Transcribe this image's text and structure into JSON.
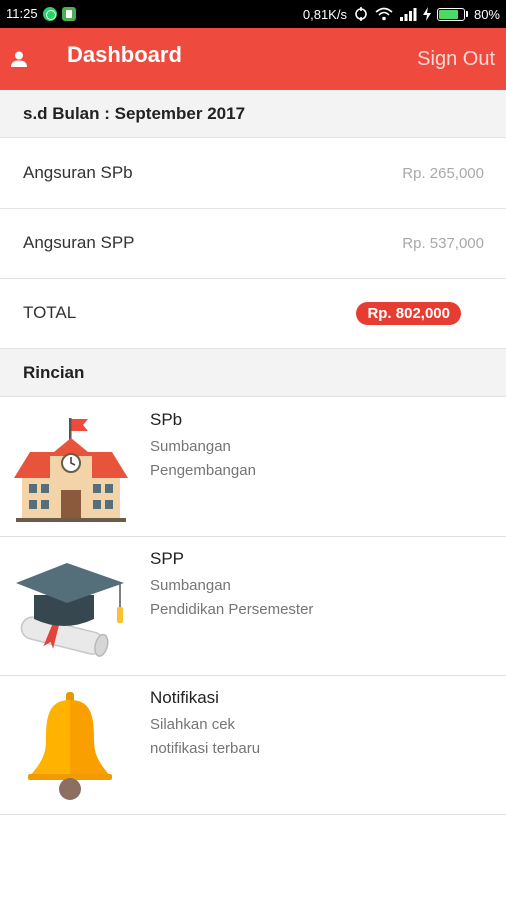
{
  "status_bar": {
    "time": "11:25",
    "network_speed": "0,81K/s",
    "battery_percent": "80%",
    "battery_level": 0.8,
    "icons": [
      "whatsapp-icon",
      "notification-app-icon",
      "sync-icon",
      "wifi-icon",
      "signal-icon",
      "charging-icon",
      "battery-icon"
    ]
  },
  "app_bar": {
    "title": "Dashboard",
    "sign_out": "Sign Out",
    "user_icon": "user-icon",
    "color": "#ee4a3d"
  },
  "period": {
    "label": "s.d Bulan : September 2017"
  },
  "summary": {
    "rows": [
      {
        "name": "Angsuran SPb",
        "amount": "Rp. 265,000"
      },
      {
        "name": "Angsuran SPP",
        "amount": "Rp. 537,000"
      }
    ],
    "total": {
      "name": "TOTAL",
      "amount": "Rp. 802,000",
      "badge_color": "#e63c31"
    }
  },
  "details": {
    "header": "Rincian",
    "items": [
      {
        "title": "SPb",
        "line1": "Sumbangan",
        "line2": "Pengembangan",
        "icon": "school-building-icon"
      },
      {
        "title": "SPP",
        "line1": "Sumbangan",
        "line2": "Pendidikan Persemester",
        "icon": "graduation-cap-diploma-icon"
      },
      {
        "title": "Notifikasi",
        "line1": "Silahkan cek",
        "line2": "notifikasi terbaru",
        "icon": "bell-icon"
      }
    ]
  }
}
